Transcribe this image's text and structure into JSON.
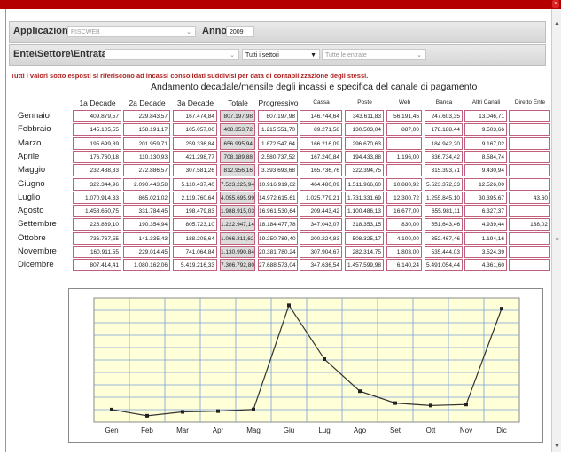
{
  "filters": {
    "app_label": "Applicazione",
    "app_value": "RISCWEB",
    "year_label": "Anno",
    "year_value": "2009",
    "ente_label": "Ente\\Settore\\Entrata",
    "ente_value": "",
    "settori_value": "Tutti i settori",
    "entrate_value": "Tutte le entrate"
  },
  "notice": "Tutti i valori sotto esposti si riferiscono ad incassi consolidati suddivisi per data di contabilizzazione degli stessi.",
  "table": {
    "title": "Andamento decadale/mensile degli incassi e specifica del canale di pagamento",
    "headers": [
      "1a Decade",
      "2a Decade",
      "3a Decade",
      "Totale",
      "Progressivo",
      "Cassa",
      "Poste",
      "Web",
      "Banca",
      "Altri Canali",
      "Diretto Ente"
    ],
    "rows": [
      {
        "month": "Gennaio",
        "values": [
          "409.879,57",
          "229.843,57",
          "167.474,84",
          "807.197,98",
          "807.197,98",
          "146.744,64",
          "343.611,83",
          "56.191,45",
          "247.603,35",
          "13.046,71",
          ""
        ]
      },
      {
        "month": "Febbraio",
        "values": [
          "145.105,55",
          "158.191,17",
          "105.057,00",
          "408.353,72",
          "1.215.551,70",
          "89.271,58",
          "130.503,04",
          "887,00",
          "178.188,44",
          "9.503,66",
          ""
        ]
      },
      {
        "month": "Marzo",
        "values": [
          "195.699,39",
          "201.959,71",
          "259.336,84",
          "656.995,94",
          "1.872.547,64",
          "166.216,09",
          "296.670,63",
          "",
          "184.942,20",
          "9.167,02",
          ""
        ]
      },
      {
        "month": "Aprile",
        "values": [
          "176.760,18",
          "110.130,93",
          "421.298,77",
          "708.189,88",
          "2.580.737,52",
          "167.240,84",
          "194.433,88",
          "1.196,00",
          "336.734,42",
          "8.584,74",
          ""
        ]
      },
      {
        "month": "Maggio",
        "values": [
          "232.488,33",
          "272.886,57",
          "307.581,26",
          "812.956,16",
          "3.393.693,68",
          "165.736,76",
          "322.394,75",
          "",
          "315.393,71",
          "9.430,94",
          ""
        ]
      },
      {
        "month": "Giugno",
        "values": [
          "322.344,96",
          "2.090.443,58",
          "5.110.437,40",
          "7.523.225,94",
          "10.916.919,62",
          "464.480,09",
          "1.511.966,60",
          "10.880,92",
          "5.523.372,33",
          "12.526,00",
          ""
        ]
      },
      {
        "month": "Luglio",
        "values": [
          "1.070.914,33",
          "865.021,02",
          "2.119.760,64",
          "4.055.695,99",
          "14.972.615,61",
          "1.025.779,21",
          "1.731.331,69",
          "12.300,72",
          "1.255.845,10",
          "30.395,67",
          "43,60"
        ]
      },
      {
        "month": "Agosto",
        "values": [
          "1.458.650,75",
          "331.784,45",
          "198.479,83",
          "1.988.915,03",
          "16.961.530,64",
          "209.443,42",
          "1.100.486,13",
          "16.677,00",
          "655.981,11",
          "6.327,37",
          ""
        ]
      },
      {
        "month": "Settembre",
        "values": [
          "226.869,10",
          "190.354,94",
          "805.723,10",
          "1.222.947,14",
          "18.184.477,78",
          "347.043,07",
          "318.353,15",
          "830,00",
          "551.643,46",
          "4.939,44",
          "138,02"
        ]
      },
      {
        "month": "Ottobre",
        "values": [
          "736.767,55",
          "141.335,43",
          "188.208,64",
          "1.066.311,62",
          "19.250.789,40",
          "200.224,83",
          "508.325,17",
          "4.100,00",
          "352.467,46",
          "1.194,16",
          ""
        ]
      },
      {
        "month": "Novembre",
        "values": [
          "160.911,55",
          "229.014,45",
          "741.064,84",
          "1.130.990,84",
          "20.381.780,24",
          "307.904,67",
          "282.314,75",
          "1.803,00",
          "535.444,03",
          "3.524,39",
          ""
        ]
      },
      {
        "month": "Dicembre",
        "values": [
          "807.414,41",
          "1.080.162,06",
          "5.419.216,33",
          "7.306.792,80",
          "27.688.573,04",
          "347.636,54",
          "1.457.599,98",
          "6.140,24",
          "5.491.054,44",
          "4.361,60",
          ""
        ]
      }
    ]
  },
  "chart_data": {
    "type": "line",
    "categories": [
      "Gen",
      "Feb",
      "Mar",
      "Apr",
      "Mag",
      "Giu",
      "Lug",
      "Ago",
      "Set",
      "Ott",
      "Nov",
      "Dic"
    ],
    "series": [
      {
        "values": [
          807197.98,
          408353.72,
          656995.94,
          708189.88,
          812956.16,
          7523225.94,
          4055695.99,
          1988915.03,
          1222947.14,
          1066311.62,
          1130990.84,
          7306792.8
        ]
      }
    ],
    "ylim": [
      0,
      8000000
    ],
    "grid": true,
    "legend": "none",
    "colors": {
      "plot_bg": "#ffffd8",
      "grid": "#7aa0d8",
      "line": "#333333"
    }
  }
}
